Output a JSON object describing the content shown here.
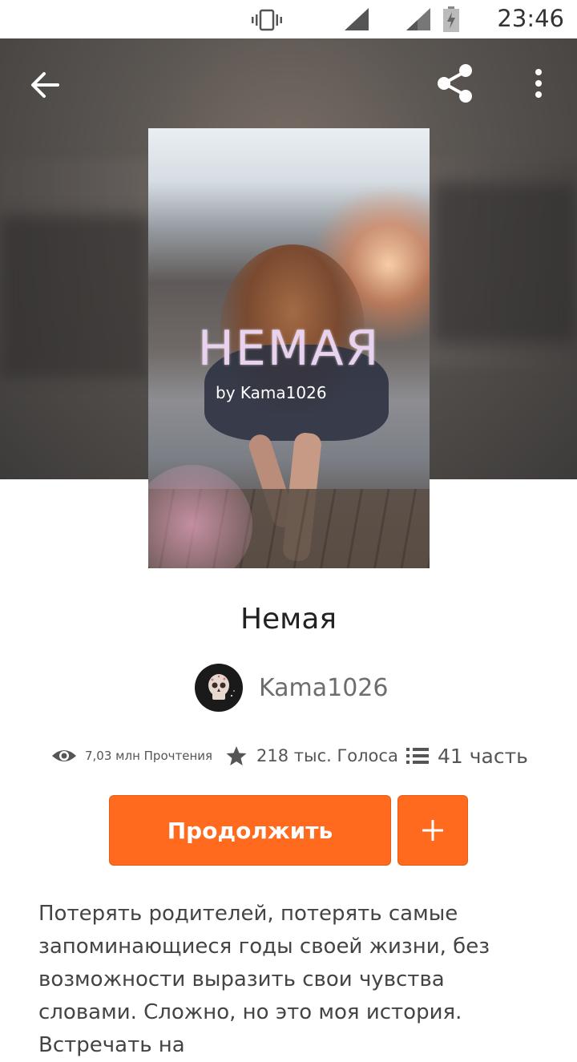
{
  "status_bar": {
    "time": "23:46",
    "icons": [
      "vibrate-icon",
      "signal-icon",
      "signal-icon",
      "battery-charging-icon"
    ]
  },
  "toolbar": {
    "back_icon": "arrow-back-icon",
    "share_icon": "share-icon",
    "more_icon": "more-vertical-icon"
  },
  "cover": {
    "title": "НЕМАЯ",
    "byline": "by Kama1026"
  },
  "story": {
    "title": "Немая",
    "author": "Kama1026",
    "stats": {
      "reads": "7,03 млн Прочтения",
      "votes": "218 тыс. Голоса",
      "parts": "41 часть"
    },
    "continue_label": "Продолжить",
    "add_label": "+",
    "description": "Потерять родителей, потерять самые запоминающиеся годы своей жизни, без возможности выразить свои чувства словами. Сложно, но это моя история. Встречать на"
  },
  "colors": {
    "accent": "#ff6a1f",
    "text_primary": "#222222",
    "text_secondary": "#6d6d6d"
  }
}
